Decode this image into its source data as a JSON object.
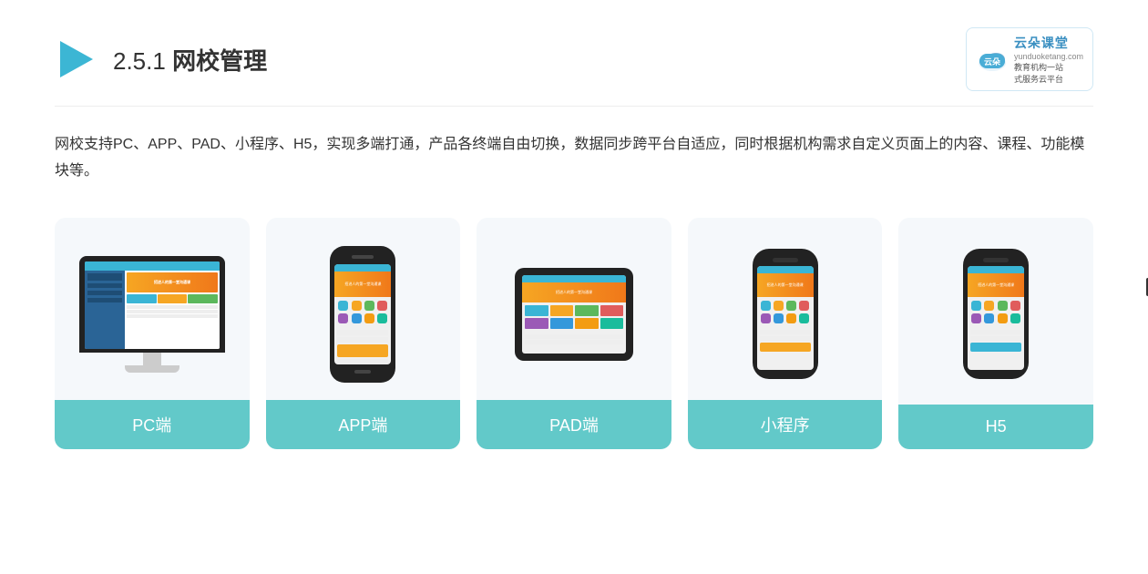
{
  "header": {
    "title_prefix": "2.5.1 ",
    "title_main": "网校管理"
  },
  "logo": {
    "brand": "云朵课堂",
    "tagline_top": "教育机构一站",
    "tagline_bottom": "式服务云平台",
    "domain": "yunduoketang.com"
  },
  "description": {
    "text": "网校支持PC、APP、PAD、小程序、H5，实现多端打通，产品各终端自由切换，数据同步跨平台自适应，同时根据机构需求自定义页面上的内容、课程、功能模块等。"
  },
  "cards": [
    {
      "label": "PC端",
      "device": "pc"
    },
    {
      "label": "APP端",
      "device": "phone"
    },
    {
      "label": "PAD端",
      "device": "pad"
    },
    {
      "label": "小程序",
      "device": "phone2"
    },
    {
      "label": "H5",
      "device": "phone3"
    }
  ]
}
